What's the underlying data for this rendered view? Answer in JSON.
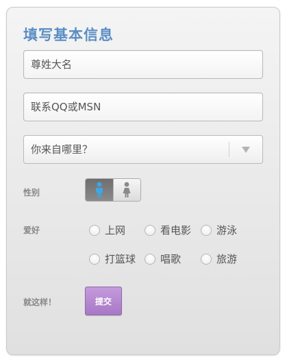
{
  "form": {
    "title": "填写基本信息",
    "name_placeholder": "尊姓大名",
    "contact_placeholder": "联系QQ或MSN",
    "origin_select": {
      "selected": "你来自哪里？"
    },
    "gender": {
      "label": "性别",
      "selected": "male",
      "options": [
        "male-icon",
        "female-icon"
      ]
    },
    "hobbies": {
      "label": "爱好",
      "options": [
        "上网",
        "看电影",
        "游泳",
        "打篮球",
        "唱歌",
        "旅游"
      ]
    },
    "submit": {
      "label": "就这样！",
      "button": "提交"
    }
  },
  "colors": {
    "title": "#5b8ec4",
    "submit_bg": "#b487d1",
    "male_icon": "#3ea6e6",
    "female_icon": "#8a8a8a"
  }
}
